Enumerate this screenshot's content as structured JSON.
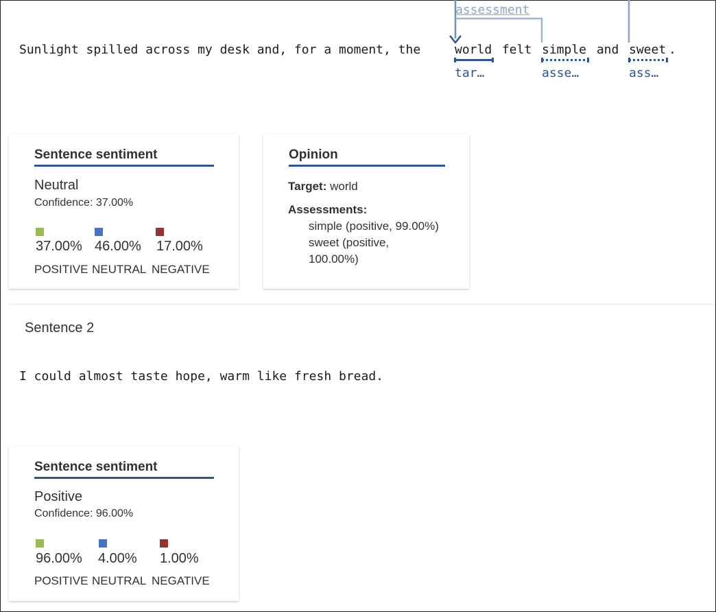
{
  "relation_label": "assessment",
  "sentence1": {
    "prefix": "Sunlight spilled across my desk and, for a moment, the ",
    "tokens": [
      {
        "text": "world",
        "tag": "tar…"
      },
      {
        "text": " felt ",
        "tag": ""
      },
      {
        "text": "simple",
        "tag": "asse…"
      },
      {
        "text": " and ",
        "tag": ""
      },
      {
        "text": "sweet",
        "tag": "ass…"
      },
      {
        "text": ".",
        "tag": ""
      }
    ]
  },
  "card1": {
    "title": "Sentence sentiment",
    "label": "Neutral",
    "confidence": "Confidence: 37.00%",
    "scores": [
      {
        "pct": "37.00%",
        "cat": "POSITIVE",
        "color": "#9bbb4f"
      },
      {
        "pct": "46.00%",
        "cat": "NEUTRAL",
        "color": "#4472c4"
      },
      {
        "pct": "17.00%",
        "cat": "NEGATIVE",
        "color": "#943434"
      }
    ]
  },
  "opinion": {
    "title": "Opinion",
    "target_label": "Target:",
    "target_value": "world",
    "assessments_label": "Assessments:",
    "assessments": [
      "simple (positive, 99.00%)",
      "sweet (positive,",
      "100.00%)"
    ]
  },
  "sentence2_header": "Sentence 2",
  "sentence2": "I could almost taste hope, warm like fresh bread.",
  "card2": {
    "title": "Sentence sentiment",
    "label": "Positive",
    "confidence": "Confidence: 96.00%",
    "scores": [
      {
        "pct": "96.00%",
        "cat": "POSITIVE",
        "color": "#9bbb4f"
      },
      {
        "pct": "4.00%",
        "cat": "NEUTRAL",
        "color": "#4472c4"
      },
      {
        "pct": "1.00%",
        "cat": "NEGATIVE",
        "color": "#943434"
      }
    ]
  }
}
